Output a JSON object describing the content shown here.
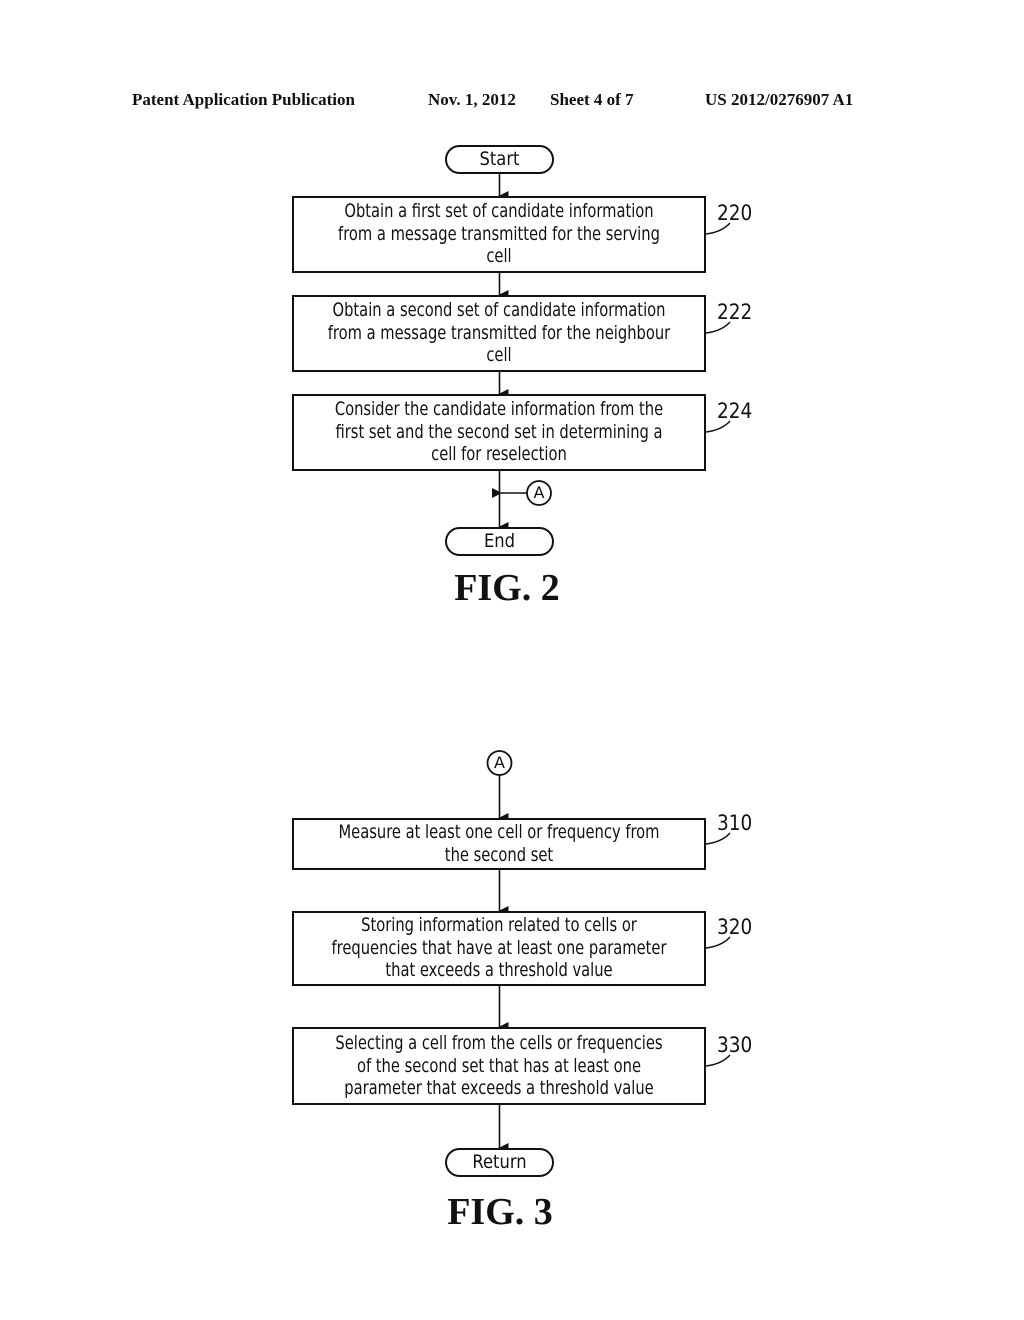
{
  "header": {
    "publication": "Patent Application Publication",
    "date": "Nov. 1, 2012",
    "sheet": "Sheet 4 of 7",
    "number": "US 2012/0276907 A1"
  },
  "fig2": {
    "label": "FIG. 2",
    "start": "Start",
    "end": "End",
    "connector": "A",
    "steps": [
      {
        "ref": "220",
        "lines": [
          "Obtain a first set of candidate information",
          "from a message transmitted for the serving",
          "cell"
        ]
      },
      {
        "ref": "222",
        "lines": [
          "Obtain a second set of candidate information",
          "from a message transmitted for the neighbour",
          "cell"
        ]
      },
      {
        "ref": "224",
        "lines": [
          "Consider the candidate information from the",
          "first set and the second set in determining a",
          "cell for reselection"
        ]
      }
    ]
  },
  "fig3": {
    "label": "FIG. 3",
    "connector": "A",
    "end": "Return",
    "steps": [
      {
        "ref": "310",
        "lines": [
          "Measure at least one cell or frequency from",
          "the second set"
        ]
      },
      {
        "ref": "320",
        "lines": [
          "Storing information related to cells or",
          "frequencies that have at least one parameter",
          "that exceeds a threshold value"
        ]
      },
      {
        "ref": "330",
        "lines": [
          "Selecting a cell from the cells or frequencies",
          "of the second set that has at least one",
          "parameter that exceeds a threshold value"
        ]
      }
    ]
  }
}
